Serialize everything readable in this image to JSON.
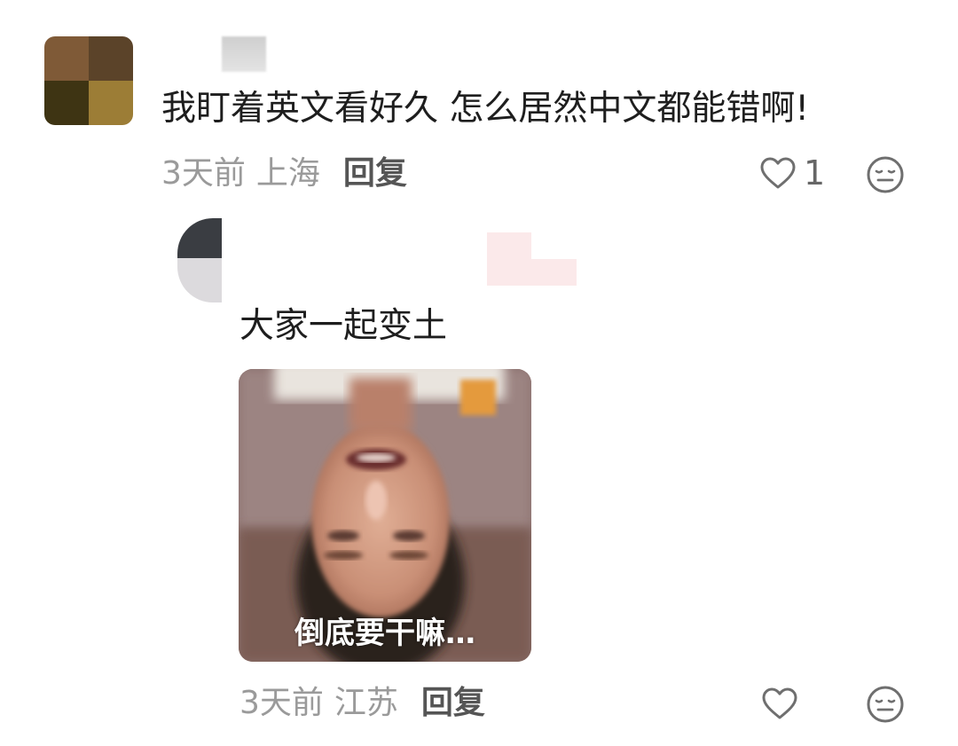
{
  "comment": {
    "text": "我盯着英文看好久 怎么居然中文都能错啊!",
    "time": "3天前",
    "location": "上海",
    "reply_label": "回复",
    "like_count": "1",
    "like_icon": "heart-outline-icon",
    "emoji_icon": "neutral-face-icon",
    "avatar_colors": [
      "#7f5a37",
      "#5b4329",
      "#3e3413",
      "#9c7d36"
    ]
  },
  "reply": {
    "text": "大家一起变土",
    "sticker": {
      "caption": "倒底要干嘛…",
      "description_icon": "upside-down-face-sticker"
    },
    "time": "3天前",
    "location": "江苏",
    "reply_label": "回复",
    "like_icon": "heart-outline-icon",
    "emoji_icon": "neutral-face-icon"
  },
  "colors": {
    "meta_gray": "#9a9a9a",
    "icon_gray": "#6f6f6f",
    "text_dark": "#1e1e1e"
  }
}
